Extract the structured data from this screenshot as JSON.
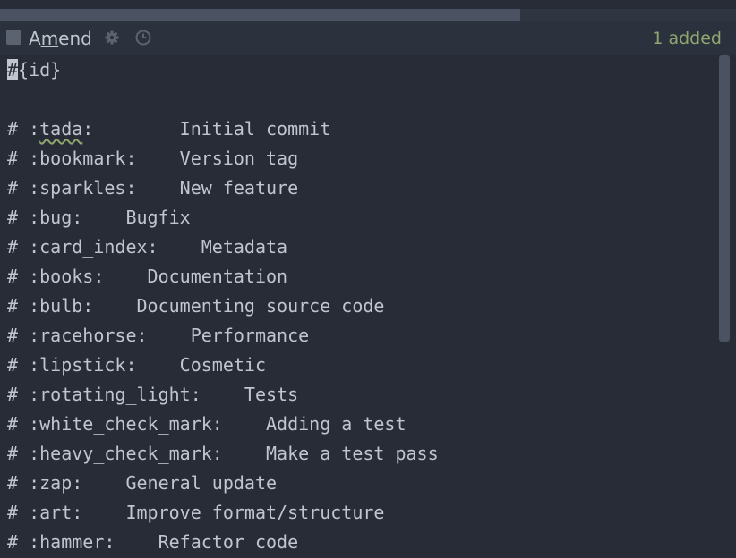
{
  "toolbar": {
    "amend_pre": "A",
    "amend_ul": "m",
    "amend_post": "end",
    "added_status": "1 added",
    "icons": [
      "gear-icon",
      "clock-icon"
    ]
  },
  "editor": {
    "first_line_cursor_char": "#",
    "first_line_rest": "{id}",
    "lines": [
      "",
      "# :tada:        Initial commit",
      "# :bookmark:    Version tag",
      "# :sparkles:    New feature",
      "# :bug:    Bugfix",
      "# :card_index:    Metadata",
      "# :books:    Documentation",
      "# :bulb:    Documenting source code",
      "# :racehorse:    Performance",
      "# :lipstick:    Cosmetic",
      "# :rotating_light:    Tests",
      "# :white_check_mark:    Adding a test",
      "# :heavy_check_mark:    Make a test pass",
      "# :zap:    General update",
      "# :art:    Improve format/structure",
      "# :hammer:    Refactor code"
    ]
  },
  "colors": {
    "background": "#272c36",
    "toolbar_bg": "#2c323d",
    "text": "#c0c5ce",
    "added_green": "#8fa66f",
    "scroll_thumb": "#4b5363"
  }
}
